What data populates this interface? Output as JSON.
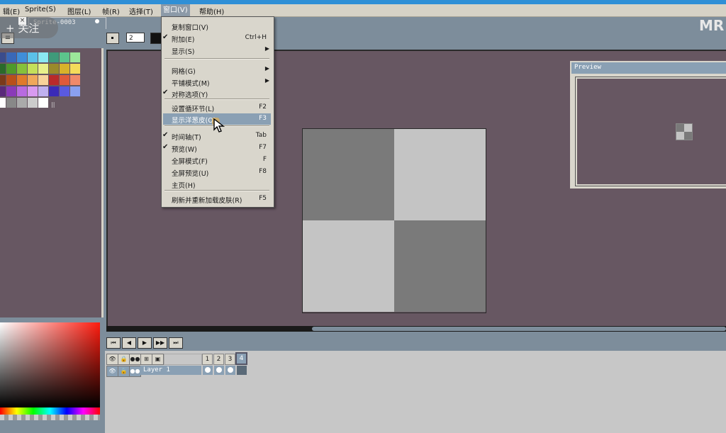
{
  "menubar": {
    "items": [
      "辑(E)",
      "Sprite(S)",
      "图层(L)",
      "帧(R)",
      "选择(T)",
      "窗口(V)",
      "帮助(H)"
    ]
  },
  "overlay": {
    "follow_label": "+ 关注",
    "watermark": "MR"
  },
  "tab": {
    "title": "Sprite-0003",
    "close": "×"
  },
  "toolbar": {
    "brush_size": "2"
  },
  "preview": {
    "title": "Preview"
  },
  "window_menu": {
    "items": [
      {
        "label": "复制窗口(V)",
        "shortcut": "",
        "checked": false,
        "submenu": false
      },
      {
        "label": "附加(E)",
        "shortcut": "Ctrl+H",
        "checked": true,
        "submenu": false
      },
      {
        "label": "显示(S)",
        "shortcut": "",
        "checked": false,
        "submenu": true
      },
      {
        "label": "网格(G)",
        "shortcut": "",
        "checked": false,
        "submenu": true
      },
      {
        "label": "平铺模式(M)",
        "shortcut": "",
        "checked": false,
        "submenu": true
      },
      {
        "label": "对称选项(Y)",
        "shortcut": "",
        "checked": true,
        "submenu": false
      },
      {
        "label": "设置循环节(L)",
        "shortcut": "F2",
        "checked": false,
        "submenu": false
      },
      {
        "label": "显示洋葱皮(O)",
        "shortcut": "F3",
        "checked": false,
        "submenu": false,
        "highlighted": true
      },
      {
        "label": "时间轴(T)",
        "shortcut": "Tab",
        "checked": true,
        "submenu": false
      },
      {
        "label": "预览(W)",
        "shortcut": "F7",
        "checked": true,
        "submenu": false
      },
      {
        "label": "全屏模式(F)",
        "shortcut": "F",
        "checked": false,
        "submenu": false
      },
      {
        "label": "全屏预览(U)",
        "shortcut": "F8",
        "checked": false,
        "submenu": false
      },
      {
        "label": "主页(H)",
        "shortcut": "",
        "checked": false,
        "submenu": false
      },
      {
        "label": "刷新并重新加载皮肤(R)",
        "shortcut": "F5",
        "checked": false,
        "submenu": false
      }
    ]
  },
  "timeline": {
    "frames": [
      "1",
      "2",
      "3",
      "4"
    ],
    "current_frame": "4",
    "layer_name": "Layer 1",
    "playback": [
      "⏮",
      "◀",
      "▶",
      "▶▶",
      "⏭"
    ]
  },
  "palette": {
    "colors": [
      [
        "#3b4c8c",
        "#3a68b8",
        "#3f8ed9",
        "#5bc1e8",
        "#8ae8f2",
        "#3f9a7a",
        "#5cc48c",
        "#9ce79a"
      ],
      [
        "#2a6a2a",
        "#4e9a2a",
        "#86c13a",
        "#c4e05a",
        "#e8f08a",
        "#9a8a2a",
        "#d8b22a",
        "#f4dc5a"
      ],
      [
        "#7a3a1a",
        "#b8501a",
        "#e07a2a",
        "#f0a85a",
        "#f8d29a",
        "#b82a2a",
        "#e05a3a",
        "#f08a6a"
      ],
      [
        "#5a2a7a",
        "#8a3ab8",
        "#b86ae0",
        "#d89af0",
        "#c0b0f0",
        "#3a2ab8",
        "#5a5ae0",
        "#8aa0f0"
      ],
      [
        "#ffffff",
        "#888888",
        "#aaaaaa",
        "#cccccc",
        "#ffffff"
      ]
    ]
  },
  "sprite": {
    "colors": {
      "dark": "#7a7a7a",
      "light": "#c4c4c4"
    }
  }
}
